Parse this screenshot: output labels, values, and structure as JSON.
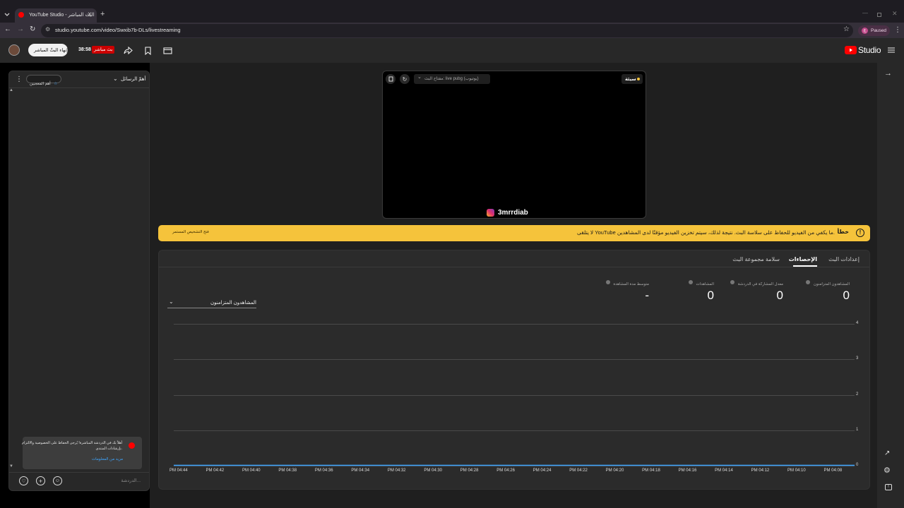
{
  "browser": {
    "tab_title": "YouTube Studio - البث المباشر",
    "tab_close": "×",
    "new_tab": "+",
    "url": "studio.youtube.com/video/Swxib7b-DLs/livestreaming",
    "profile_initial": "ع",
    "profile_status": "Paused"
  },
  "header": {
    "brand": "Studio",
    "end_stream_label": "إنهاء البثّ المباشر",
    "timer": "38:58",
    "live_badge": "بث مباشر"
  },
  "chat": {
    "top_chat_label": "أهمّ الرسائل",
    "top_fans_label": "أهم المعجبين",
    "notice_text_1": "أهلاً بك في الدردشة المباشرة! يُرجى الحفاظ على الخصوصية والالتزام",
    "notice_text_2": "بإرشادات المنتدى.",
    "learn_more": "مزيد من المعلومات",
    "input_placeholder": "الدردشة..."
  },
  "preview": {
    "healthy_badge": "سيئة",
    "stream_key_label": "مفتاح البث: live pubg (يوتيوب)",
    "channel_watermark": "3mrrdiab"
  },
  "warning": {
    "title": "خطأ",
    "message": "لا يتلقى YouTube ما يكفي من الفيديو للحفاظ على سلاسة البث. نتيجة لذلك، سيتم تخزين الفيديو مؤقتًا لدى المشاهدين.",
    "action": "فتح التشخيص المستمر"
  },
  "tabs": [
    {
      "label": "إعدادات البث"
    },
    {
      "label": "الإحصاءات"
    },
    {
      "label": "سلامة مجموعة البث"
    }
  ],
  "stats": [
    {
      "label": "المشاهدون المتزامنون",
      "value": "0"
    },
    {
      "label": "معدل المشاركة في الدردشة",
      "value": "0"
    },
    {
      "label": "المشاهدات",
      "value": "0"
    },
    {
      "label": "متوسط مدة المشاهدة",
      "value": "-"
    }
  ],
  "chart_selector": "المشاهدون المتزامنون",
  "chart_data": {
    "type": "line",
    "series": [
      {
        "values": [
          0,
          0,
          0,
          0,
          0,
          0,
          0,
          0,
          0,
          0,
          0,
          0,
          0,
          0,
          0,
          0,
          0,
          0,
          0
        ]
      }
    ],
    "x": [
      "PM 04:44",
      "PM 04:42",
      "PM 04:40",
      "PM 04:38",
      "PM 04:36",
      "PM 04:34",
      "PM 04:32",
      "PM 04:30",
      "PM 04:28",
      "PM 04:26",
      "PM 04:24",
      "PM 04:22",
      "PM 04:20",
      "PM 04:18",
      "PM 04:16",
      "PM 04:14",
      "PM 04:12",
      "PM 04:10",
      "PM 04:08"
    ],
    "y_ticks": [
      "4",
      "3",
      "2",
      "1",
      "0"
    ],
    "ylim": [
      0,
      4
    ],
    "grid": true,
    "colors": {
      "line": "#3ea6ff"
    }
  },
  "colors": {
    "warning_bg": "#f5c33b",
    "live_red": "#cc0000",
    "youtube_red": "#ff0000"
  }
}
